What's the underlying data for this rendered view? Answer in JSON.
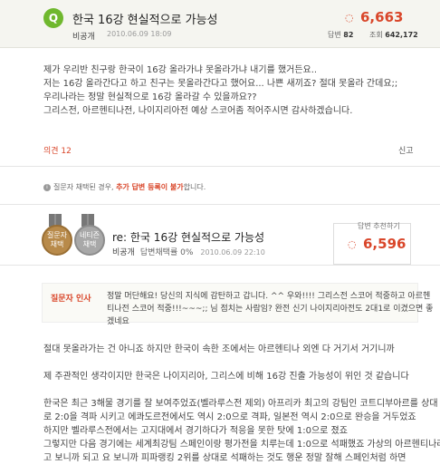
{
  "question": {
    "badge": "Q",
    "title": "한국 16강 현실적으로 가능성",
    "user": "비공개",
    "date": "2010.06.09 18:09",
    "points": "6,663",
    "answers_label": "답변",
    "answers": "82",
    "views_label": "조회",
    "views": "642,172",
    "body": [
      "제가 우리반 친구랑 한국이 16강 올라가냐 못올라가냐 내기를 했거든요..",
      "저는 16강 올라간다고 하고 친구는 못올라간다고 했어요... 나쁜 새끼죠? 절대 못올라 간데요;;",
      "우리나라는 정말 현실적으로 16강 올라갈 수 있을까요??",
      "그리스전, 아르헨티나전, 나이지리아전 예상 스코어좀 적어주시면 감사하겠습니다."
    ],
    "opinion": "의견 12",
    "report": "신고"
  },
  "notice": {
    "prefix": "질문자 채택된 경우,",
    "highlight": "추가 답변 등록이 불가",
    "suffix": "합니다."
  },
  "answer": {
    "medals": [
      "질문자 채택",
      "네티즌 채택"
    ],
    "title": "re: 한국 16강 현실적으로 가능성",
    "user": "비공개",
    "level": "답변채택률 0%",
    "date": "2010.06.09 22:10",
    "recommend_label": "답변 추천하기",
    "points": "6,596",
    "thanks_label": "질문자 인사",
    "thanks_text": [
      "정말 머단해요! 당신의 지식에 감탄하고 갑니다. ^^ 우와!!!! 그리스전 스코어 적중하고 아르헨",
      "티나전 스코어 적중!!!~~~;; 님 점치는 사람임? 완전 신기 나이지리아전도 2대1로 이겼으면 좋",
      "겠네요"
    ],
    "body": [
      "절대 못올라가는 건 아니죠 하지만 한국이 속한 조에서는 아르헨티나 외엔 다 거기서 거기니까",
      "",
      "제 주관적인 생각이지만 한국은 나이지리아, 그리스에 비해 16강 진출 가능성이 위인 것 같습니다",
      "",
      "한국은 최근 3해물 경기를 잘 보여주었죠(벨라루스전 제외) 아프리카 최고의 강팀인 코트디부아르를 상대",
      "로 2:0을 격파 시키고 에콰도르전에서도 역시 2:0으로 격파, 일본전 역시 2:0으로 완승을 거두었죠",
      "하지만 벨라루스전에서는 고지대에서 경기하다가 적응을 못한 탓에 1:0으로 졌죠",
      "그렇지만 다음 경기에는 세계최강팀 스페인이랑 평가전을 치루는데 1:0으로 석패했죠 가상의 아르헨티나라",
      "고 보니까 되고 요 보니까 피파랭킹 2위를 상대로 석패하는 것도 행운 정말 잘해 스페인처럼 하면"
    ]
  }
}
